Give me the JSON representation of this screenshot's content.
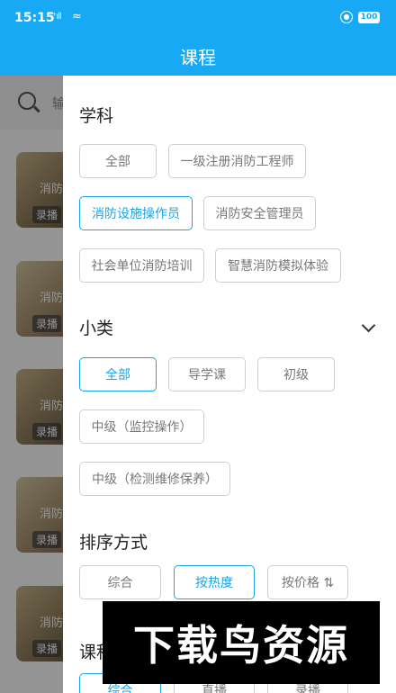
{
  "status": {
    "time": "15:15",
    "signal": "⁺ıll",
    "battery": "100"
  },
  "header": {
    "title": "课程"
  },
  "background": {
    "search_placeholder": "输",
    "cards": [
      {
        "title": "消防",
        "tag": "录播"
      },
      {
        "title": "消防",
        "tag": "录播"
      },
      {
        "title": "消防",
        "tag": "录播"
      },
      {
        "title": "消防",
        "tag": "录播"
      },
      {
        "title": "消防",
        "tag": "录播"
      }
    ]
  },
  "filters": {
    "subject": {
      "title": "学科",
      "options": [
        "全部",
        "一级注册消防工程师",
        "消防设施操作员",
        "消防安全管理员",
        "社会单位消防培训",
        "智慧消防模拟体验"
      ],
      "selected": "消防设施操作员"
    },
    "category": {
      "title": "小类",
      "options": [
        "全部",
        "导学课",
        "初级",
        "中级（监控操作）",
        "中级（检测维修保养）"
      ],
      "selected": "全部"
    },
    "sort": {
      "title": "排序方式",
      "options": [
        "综合",
        "按热度",
        "按价格 ⇅"
      ],
      "selected": "按热度"
    },
    "type": {
      "title": "课程",
      "options": [
        "综合",
        "直播",
        "录播"
      ]
    }
  },
  "watermark": "下载鸟资源",
  "colors": {
    "primary": "#17a9f4",
    "selected_border": "#18a4ea"
  }
}
